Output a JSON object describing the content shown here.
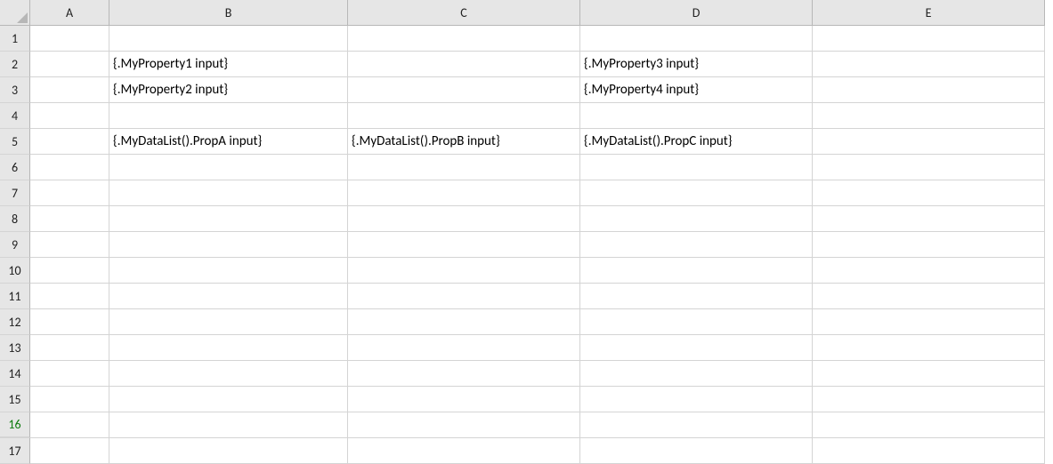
{
  "columns": [
    "A",
    "B",
    "C",
    "D",
    "E"
  ],
  "rowCount": 17,
  "selectedRow": 16,
  "cells": {
    "r2": {
      "B": "{.MyProperty1 input}",
      "D": "{.MyProperty3 input}"
    },
    "r3": {
      "B": "{.MyProperty2 input}",
      "D": "{.MyProperty4 input}"
    },
    "r5": {
      "B": "{.MyDataList().PropA input}",
      "C": "{.MyDataList().PropB input}",
      "D": "{.MyDataList().PropC input}"
    }
  }
}
